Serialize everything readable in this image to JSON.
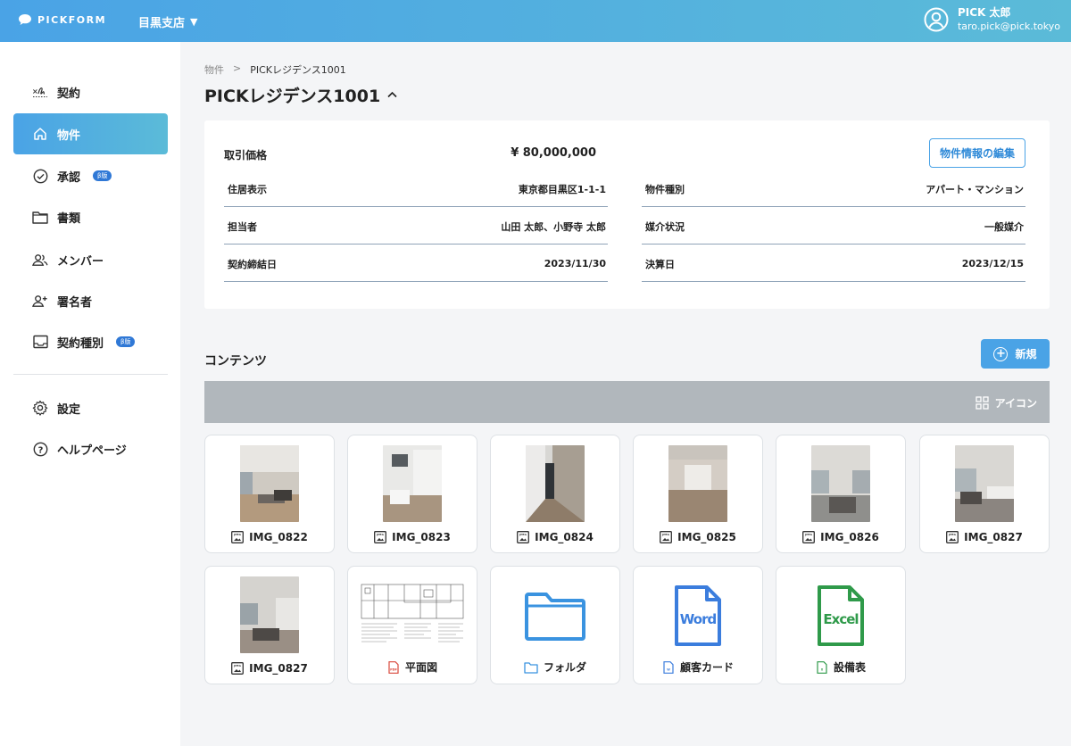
{
  "header": {
    "logo_text": "PICKFORM",
    "branch": "目黒支店",
    "user_name": "PICK 太郎",
    "user_email": "taro.pick@pick.tokyo"
  },
  "sidebar": {
    "items": [
      {
        "label": "契約",
        "icon": "signature-icon"
      },
      {
        "label": "物件",
        "icon": "home-icon",
        "active": true
      },
      {
        "label": "承認",
        "icon": "check-circle-icon",
        "badge": "β版"
      },
      {
        "label": "書類",
        "icon": "folder-icon"
      },
      {
        "label": "メンバー",
        "icon": "users-icon"
      },
      {
        "label": "署名者",
        "icon": "user-plus-icon"
      },
      {
        "label": "契約種別",
        "icon": "inbox-icon",
        "badge": "β版"
      },
      {
        "label": "設定",
        "icon": "gear-icon"
      },
      {
        "label": "ヘルプページ",
        "icon": "help-icon"
      }
    ]
  },
  "breadcrumb": {
    "parent": "物件",
    "separator": ">",
    "current": "PICKレジデンス1001"
  },
  "page": {
    "title": "PICKレジデンス1001",
    "title_toggle": "^"
  },
  "property": {
    "price_label": "取引価格",
    "price_value": "¥ 80,000,000",
    "edit_button": "物件情報の編集",
    "fields": [
      {
        "label": "住居表示",
        "value": "東京都目黒区1-1-1"
      },
      {
        "label": "物件種別",
        "value": "アパート・マンション"
      },
      {
        "label": "担当者",
        "value": "山田 太郎、小野寺 太郎"
      },
      {
        "label": "媒介状況",
        "value": "一般媒介"
      },
      {
        "label": "契約締結日",
        "value": "2023/11/30"
      },
      {
        "label": "決算日",
        "value": "2023/12/15"
      }
    ]
  },
  "contents": {
    "title": "コンテンツ",
    "new_button": "新規",
    "view_label": "アイコン",
    "items": [
      {
        "name": "IMG_0822",
        "type": "jpeg"
      },
      {
        "name": "IMG_0823",
        "type": "jpeg"
      },
      {
        "name": "IMG_0824",
        "type": "jpeg"
      },
      {
        "name": "IMG_0825",
        "type": "jpeg"
      },
      {
        "name": "IMG_0826",
        "type": "jpeg"
      },
      {
        "name": "IMG_0827",
        "type": "jpeg"
      },
      {
        "name": "IMG_0827",
        "type": "jpeg"
      },
      {
        "name": "平面図",
        "type": "pdf"
      },
      {
        "name": "フォルダ",
        "type": "folder"
      },
      {
        "name": "顧客カード",
        "type": "word"
      },
      {
        "name": "設備表",
        "type": "excel"
      }
    ]
  },
  "colors": {
    "accent": "#4aa3e6",
    "sidebar_active": "#5bbbd8",
    "word": "#3b7ddd",
    "excel": "#2f9a4a",
    "folder": "#3a93e0",
    "pdf": "#d9483b"
  }
}
